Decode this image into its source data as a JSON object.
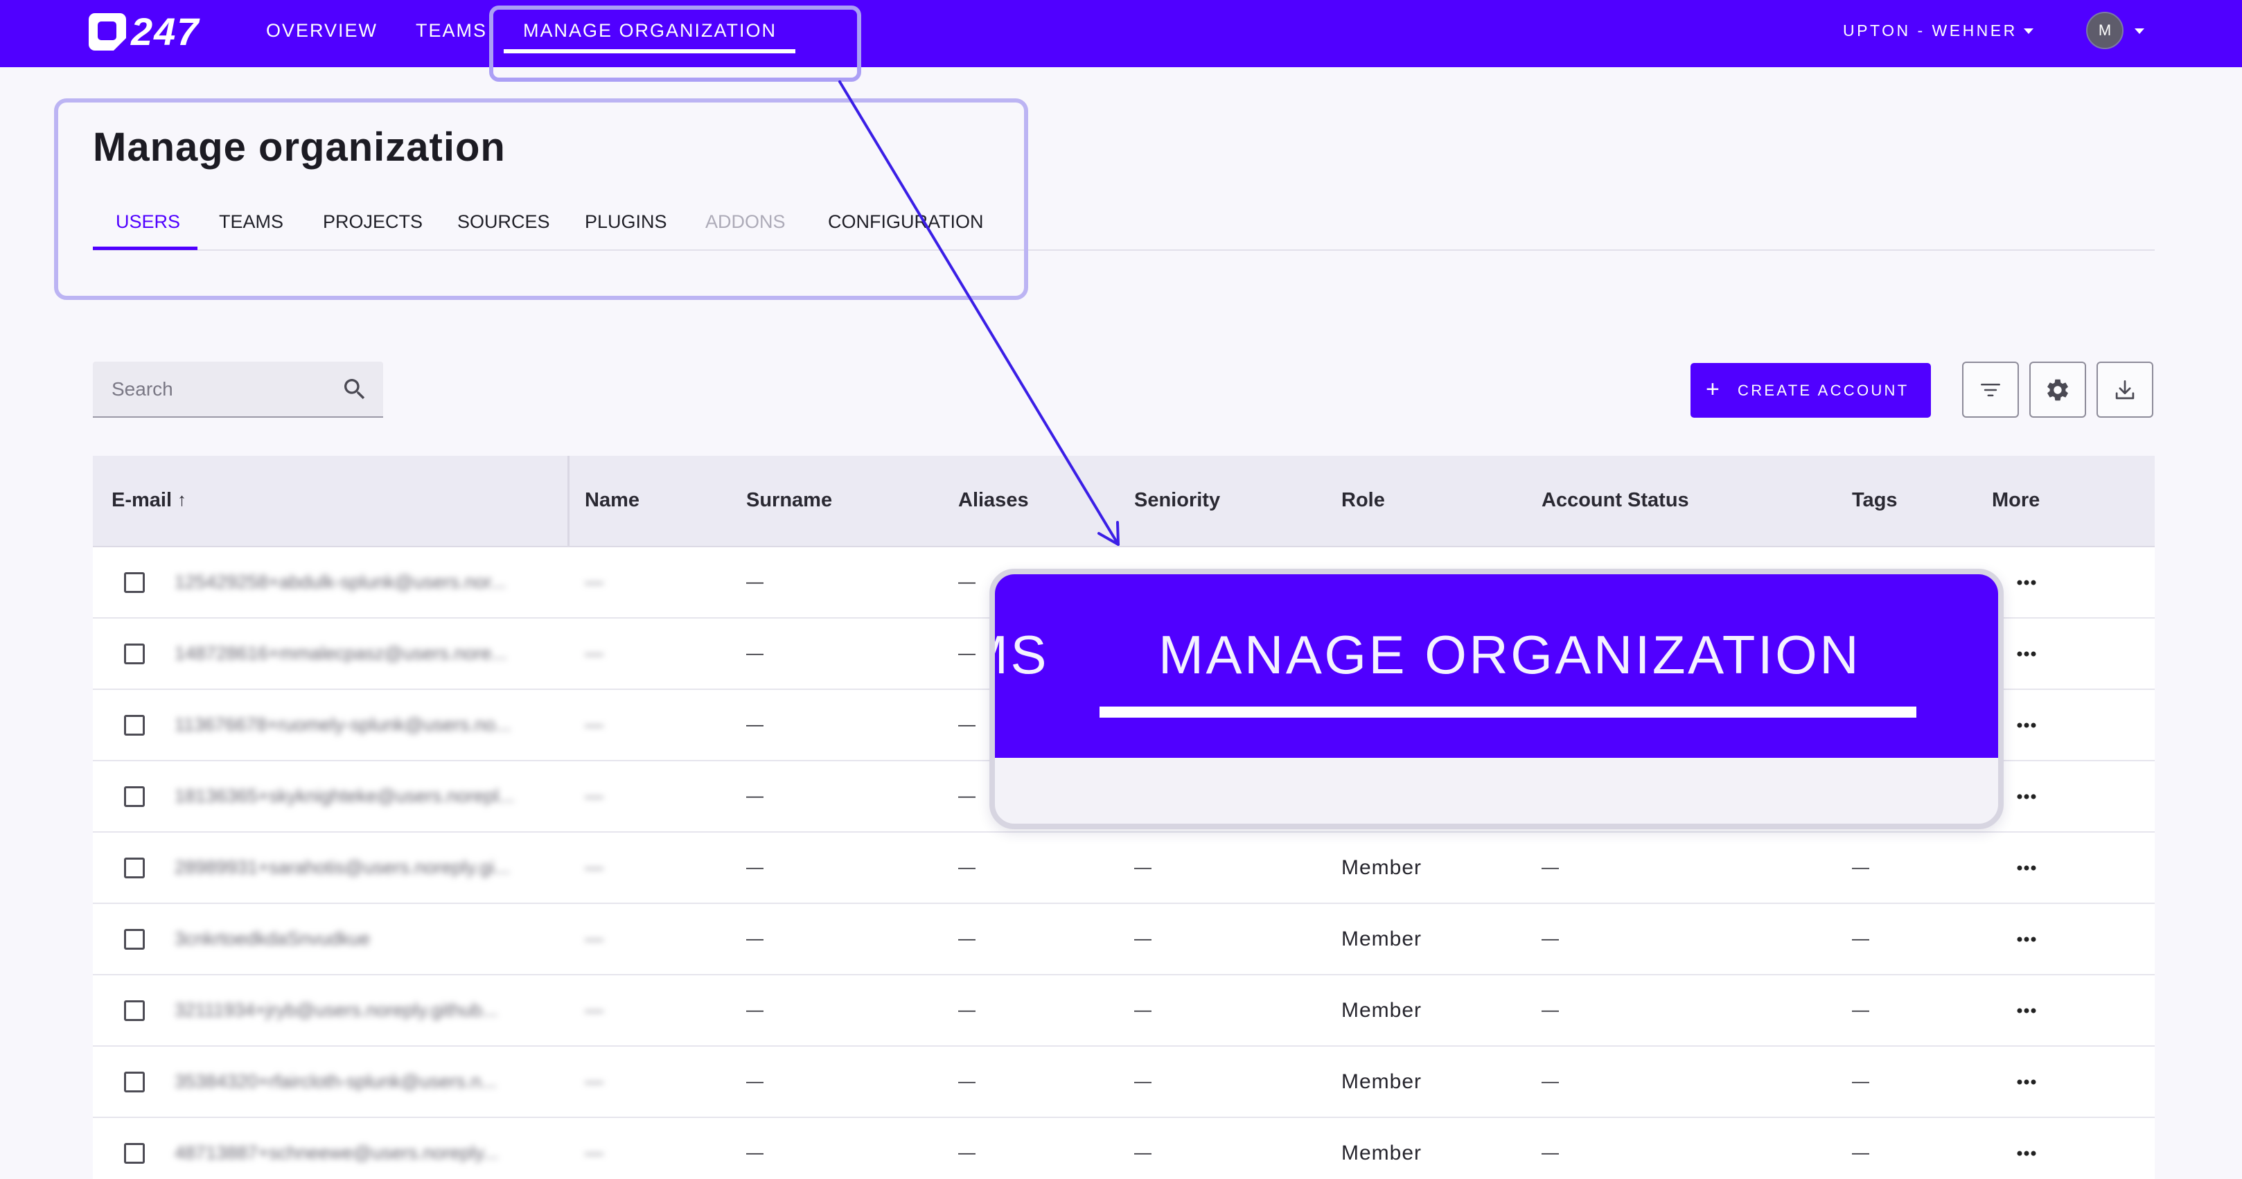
{
  "app": {
    "logo_text": "247",
    "logo_icon": "q-logo-icon"
  },
  "colors": {
    "brand": "#5000ff",
    "highlight": "#ab9ff5",
    "arrow": "#3b1fe6"
  },
  "nav": {
    "items": [
      {
        "label": "OVERVIEW"
      },
      {
        "label": "TEAMS"
      },
      {
        "label": "MANAGE ORGANIZATION",
        "active": true
      }
    ],
    "org_name": "UPTON - WEHNER",
    "avatar_initial": "M"
  },
  "page": {
    "title": "Manage organization",
    "tabs": [
      {
        "label": "USERS",
        "active": true
      },
      {
        "label": "TEAMS"
      },
      {
        "label": "PROJECTS"
      },
      {
        "label": "SOURCES"
      },
      {
        "label": "PLUGINS"
      },
      {
        "label": "ADDONS",
        "disabled": true
      },
      {
        "label": "CONFIGURATION"
      }
    ]
  },
  "toolbar": {
    "search_placeholder": "Search",
    "create_label": "CREATE ACCOUNT",
    "icons": [
      "search-icon",
      "plus-icon",
      "filter-icon",
      "gear-icon",
      "download-icon"
    ]
  },
  "table": {
    "columns": {
      "email": "E-mail",
      "name": "Name",
      "surname": "Surname",
      "aliases": "Aliases",
      "seniority": "Seniority",
      "role": "Role",
      "account_status": "Account Status",
      "tags": "Tags",
      "more": "More"
    },
    "sort": {
      "column": "email",
      "direction": "asc"
    },
    "rows": [
      {
        "email": "125429258+abdulk-splunk@users.nor...",
        "name": "—",
        "surname": "—",
        "aliases": "—"
      },
      {
        "email": "148728616+mmalecpasz@users.nore...",
        "name": "—",
        "surname": "—",
        "aliases": "—"
      },
      {
        "email": "113676678+ruomely-splunk@users.no...",
        "name": "—",
        "surname": "—",
        "aliases": "—"
      },
      {
        "email": "18136365+skyknighteke@users.norepl...",
        "name": "—",
        "surname": "—",
        "aliases": "—"
      },
      {
        "email": "28989931+sarahotis@users.noreply.gi...",
        "name": "—",
        "surname": "—",
        "aliases": "—",
        "seniority": "—",
        "role": "Member",
        "account_status": "—",
        "tags": "—"
      },
      {
        "email": "3cnkrtoedkdaSnvudkue",
        "name": "—",
        "surname": "—",
        "aliases": "—",
        "seniority": "—",
        "role": "Member",
        "account_status": "—",
        "tags": "—"
      },
      {
        "email": "32111934+jryb@users.noreply.github...",
        "name": "—",
        "surname": "—",
        "aliases": "—",
        "seniority": "—",
        "role": "Member",
        "account_status": "—",
        "tags": "—"
      },
      {
        "email": "35384320+rfaircloth-splunk@users.n...",
        "name": "—",
        "surname": "—",
        "aliases": "—",
        "seniority": "—",
        "role": "Member",
        "account_status": "—",
        "tags": "—"
      },
      {
        "email": "48713887+schneewe@users.noreply...",
        "name": "—",
        "surname": "—",
        "aliases": "—",
        "seniority": "—",
        "role": "Member",
        "account_status": "—",
        "tags": "—"
      }
    ]
  },
  "zoom_callout": {
    "label": "MANAGE ORGANIZATION",
    "partial_label": "MS"
  }
}
